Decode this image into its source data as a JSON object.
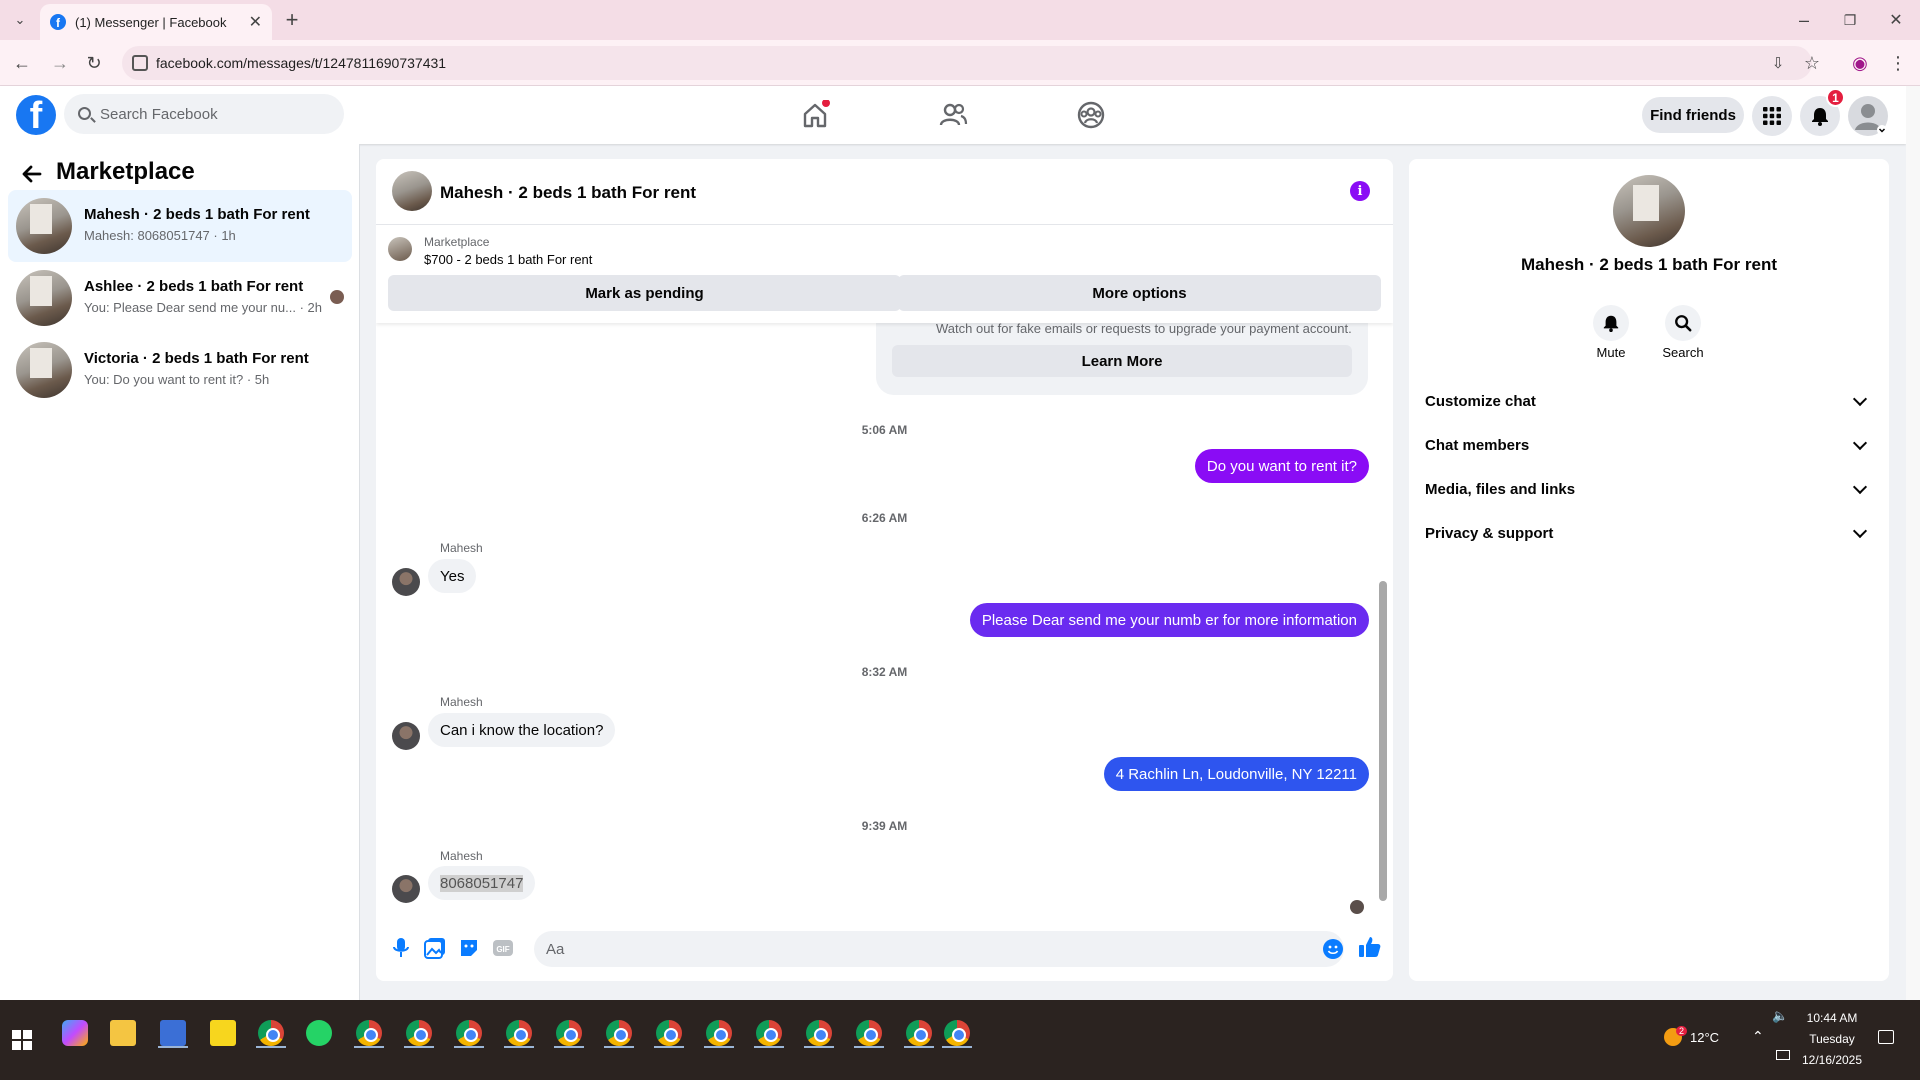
{
  "browser": {
    "tab_title": "(1) Messenger | Facebook",
    "url": "facebook.com/messages/t/1247811690737431"
  },
  "fb_header": {
    "search_placeholder": "Search Facebook",
    "find_friends_label": "Find friends",
    "notification_count": "1"
  },
  "sidebar": {
    "title": "Marketplace",
    "conversations": [
      {
        "title": "Mahesh · 2 beds 1 bath For rent",
        "preview": "Mahesh: 8068051747 · 1h",
        "active": true
      },
      {
        "title": "Ashlee · 2 beds 1 bath For rent",
        "preview": "You: Please Dear send me your nu... · 2h",
        "active": false
      },
      {
        "title": "Victoria · 2 beds 1 bath For rent",
        "preview": "You: Do you want to rent it? · 5h",
        "active": false
      }
    ]
  },
  "chat": {
    "header_title": "Mahesh · 2 beds 1 bath For rent",
    "marketplace_label": "Marketplace",
    "listing": "$700 - 2 beds 1 bath For rent",
    "mark_pending_label": "Mark as pending",
    "more_options_label": "More options",
    "warning_text": "Watch out for fake emails or requests to upgrade your payment account.",
    "learn_more_label": "Learn More",
    "timestamps": [
      "5:06 AM",
      "6:26 AM",
      "8:32 AM",
      "9:39 AM"
    ],
    "messages": [
      {
        "from": "me",
        "text": "Do you want to rent it?"
      },
      {
        "from": "Mahesh",
        "text": "Yes"
      },
      {
        "from": "me",
        "text": "Please Dear send me your numb er for more information"
      },
      {
        "from": "Mahesh",
        "text": "Can i know the location?"
      },
      {
        "from": "me",
        "text": "4 Rachlin Ln, Loudonville, NY 12211"
      },
      {
        "from": "Mahesh",
        "text": "8068051747"
      }
    ],
    "input_placeholder": "Aa"
  },
  "info_panel": {
    "title": "Mahesh · 2 beds 1 bath For rent",
    "actions": [
      {
        "label": "Mute",
        "icon": "bell-icon"
      },
      {
        "label": "Search",
        "icon": "search-icon"
      }
    ],
    "sections": [
      "Customize chat",
      "Chat members",
      "Media, files and links",
      "Privacy & support"
    ]
  },
  "taskbar": {
    "weather": "12°C",
    "weather_badge": "2",
    "time": "10:44 AM",
    "day": "Tuesday",
    "date": "12/16/2025"
  },
  "colors": {
    "fb_blue": "#1877f2",
    "bubble_purple": "#8a0cf5",
    "bubble_indigo": "#5b3cf6",
    "bubble_blue": "#2e55ef",
    "active_conv": "#ebf5ff"
  }
}
